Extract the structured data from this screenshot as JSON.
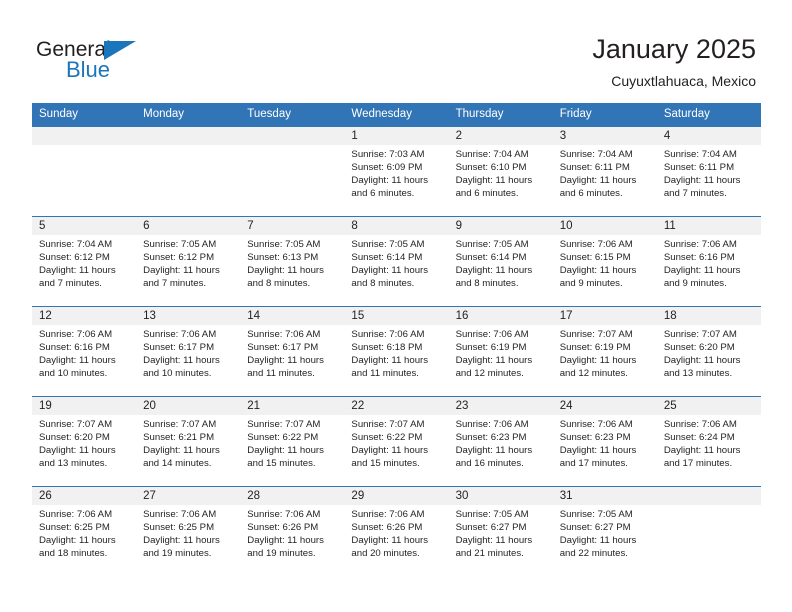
{
  "brand": {
    "name_dark": "General",
    "name_blue": "Blue",
    "accent_color": "#1b75bb"
  },
  "header": {
    "title": "January 2025",
    "subtitle": "Cuyuxtlahuaca, Mexico"
  },
  "colors": {
    "header_blue": "#3275b6",
    "date_band_gray": "#f1f1f1",
    "text": "#231f20"
  },
  "weekdays": [
    "Sunday",
    "Monday",
    "Tuesday",
    "Wednesday",
    "Thursday",
    "Friday",
    "Saturday"
  ],
  "weeks": [
    [
      {
        "day": "",
        "empty": true,
        "sunrise": "",
        "sunset": "",
        "daylight1": "",
        "daylight2": ""
      },
      {
        "day": "",
        "empty": true,
        "sunrise": "",
        "sunset": "",
        "daylight1": "",
        "daylight2": ""
      },
      {
        "day": "",
        "empty": true,
        "sunrise": "",
        "sunset": "",
        "daylight1": "",
        "daylight2": ""
      },
      {
        "day": "1",
        "empty": false,
        "sunrise": "Sunrise: 7:03 AM",
        "sunset": "Sunset: 6:09 PM",
        "daylight1": "Daylight: 11 hours",
        "daylight2": "and 6 minutes."
      },
      {
        "day": "2",
        "empty": false,
        "sunrise": "Sunrise: 7:04 AM",
        "sunset": "Sunset: 6:10 PM",
        "daylight1": "Daylight: 11 hours",
        "daylight2": "and 6 minutes."
      },
      {
        "day": "3",
        "empty": false,
        "sunrise": "Sunrise: 7:04 AM",
        "sunset": "Sunset: 6:11 PM",
        "daylight1": "Daylight: 11 hours",
        "daylight2": "and 6 minutes."
      },
      {
        "day": "4",
        "empty": false,
        "sunrise": "Sunrise: 7:04 AM",
        "sunset": "Sunset: 6:11 PM",
        "daylight1": "Daylight: 11 hours",
        "daylight2": "and 7 minutes."
      }
    ],
    [
      {
        "day": "5",
        "empty": false,
        "sunrise": "Sunrise: 7:04 AM",
        "sunset": "Sunset: 6:12 PM",
        "daylight1": "Daylight: 11 hours",
        "daylight2": "and 7 minutes."
      },
      {
        "day": "6",
        "empty": false,
        "sunrise": "Sunrise: 7:05 AM",
        "sunset": "Sunset: 6:12 PM",
        "daylight1": "Daylight: 11 hours",
        "daylight2": "and 7 minutes."
      },
      {
        "day": "7",
        "empty": false,
        "sunrise": "Sunrise: 7:05 AM",
        "sunset": "Sunset: 6:13 PM",
        "daylight1": "Daylight: 11 hours",
        "daylight2": "and 8 minutes."
      },
      {
        "day": "8",
        "empty": false,
        "sunrise": "Sunrise: 7:05 AM",
        "sunset": "Sunset: 6:14 PM",
        "daylight1": "Daylight: 11 hours",
        "daylight2": "and 8 minutes."
      },
      {
        "day": "9",
        "empty": false,
        "sunrise": "Sunrise: 7:05 AM",
        "sunset": "Sunset: 6:14 PM",
        "daylight1": "Daylight: 11 hours",
        "daylight2": "and 8 minutes."
      },
      {
        "day": "10",
        "empty": false,
        "sunrise": "Sunrise: 7:06 AM",
        "sunset": "Sunset: 6:15 PM",
        "daylight1": "Daylight: 11 hours",
        "daylight2": "and 9 minutes."
      },
      {
        "day": "11",
        "empty": false,
        "sunrise": "Sunrise: 7:06 AM",
        "sunset": "Sunset: 6:16 PM",
        "daylight1": "Daylight: 11 hours",
        "daylight2": "and 9 minutes."
      }
    ],
    [
      {
        "day": "12",
        "empty": false,
        "sunrise": "Sunrise: 7:06 AM",
        "sunset": "Sunset: 6:16 PM",
        "daylight1": "Daylight: 11 hours",
        "daylight2": "and 10 minutes."
      },
      {
        "day": "13",
        "empty": false,
        "sunrise": "Sunrise: 7:06 AM",
        "sunset": "Sunset: 6:17 PM",
        "daylight1": "Daylight: 11 hours",
        "daylight2": "and 10 minutes."
      },
      {
        "day": "14",
        "empty": false,
        "sunrise": "Sunrise: 7:06 AM",
        "sunset": "Sunset: 6:17 PM",
        "daylight1": "Daylight: 11 hours",
        "daylight2": "and 11 minutes."
      },
      {
        "day": "15",
        "empty": false,
        "sunrise": "Sunrise: 7:06 AM",
        "sunset": "Sunset: 6:18 PM",
        "daylight1": "Daylight: 11 hours",
        "daylight2": "and 11 minutes."
      },
      {
        "day": "16",
        "empty": false,
        "sunrise": "Sunrise: 7:06 AM",
        "sunset": "Sunset: 6:19 PM",
        "daylight1": "Daylight: 11 hours",
        "daylight2": "and 12 minutes."
      },
      {
        "day": "17",
        "empty": false,
        "sunrise": "Sunrise: 7:07 AM",
        "sunset": "Sunset: 6:19 PM",
        "daylight1": "Daylight: 11 hours",
        "daylight2": "and 12 minutes."
      },
      {
        "day": "18",
        "empty": false,
        "sunrise": "Sunrise: 7:07 AM",
        "sunset": "Sunset: 6:20 PM",
        "daylight1": "Daylight: 11 hours",
        "daylight2": "and 13 minutes."
      }
    ],
    [
      {
        "day": "19",
        "empty": false,
        "sunrise": "Sunrise: 7:07 AM",
        "sunset": "Sunset: 6:20 PM",
        "daylight1": "Daylight: 11 hours",
        "daylight2": "and 13 minutes."
      },
      {
        "day": "20",
        "empty": false,
        "sunrise": "Sunrise: 7:07 AM",
        "sunset": "Sunset: 6:21 PM",
        "daylight1": "Daylight: 11 hours",
        "daylight2": "and 14 minutes."
      },
      {
        "day": "21",
        "empty": false,
        "sunrise": "Sunrise: 7:07 AM",
        "sunset": "Sunset: 6:22 PM",
        "daylight1": "Daylight: 11 hours",
        "daylight2": "and 15 minutes."
      },
      {
        "day": "22",
        "empty": false,
        "sunrise": "Sunrise: 7:07 AM",
        "sunset": "Sunset: 6:22 PM",
        "daylight1": "Daylight: 11 hours",
        "daylight2": "and 15 minutes."
      },
      {
        "day": "23",
        "empty": false,
        "sunrise": "Sunrise: 7:06 AM",
        "sunset": "Sunset: 6:23 PM",
        "daylight1": "Daylight: 11 hours",
        "daylight2": "and 16 minutes."
      },
      {
        "day": "24",
        "empty": false,
        "sunrise": "Sunrise: 7:06 AM",
        "sunset": "Sunset: 6:23 PM",
        "daylight1": "Daylight: 11 hours",
        "daylight2": "and 17 minutes."
      },
      {
        "day": "25",
        "empty": false,
        "sunrise": "Sunrise: 7:06 AM",
        "sunset": "Sunset: 6:24 PM",
        "daylight1": "Daylight: 11 hours",
        "daylight2": "and 17 minutes."
      }
    ],
    [
      {
        "day": "26",
        "empty": false,
        "sunrise": "Sunrise: 7:06 AM",
        "sunset": "Sunset: 6:25 PM",
        "daylight1": "Daylight: 11 hours",
        "daylight2": "and 18 minutes."
      },
      {
        "day": "27",
        "empty": false,
        "sunrise": "Sunrise: 7:06 AM",
        "sunset": "Sunset: 6:25 PM",
        "daylight1": "Daylight: 11 hours",
        "daylight2": "and 19 minutes."
      },
      {
        "day": "28",
        "empty": false,
        "sunrise": "Sunrise: 7:06 AM",
        "sunset": "Sunset: 6:26 PM",
        "daylight1": "Daylight: 11 hours",
        "daylight2": "and 19 minutes."
      },
      {
        "day": "29",
        "empty": false,
        "sunrise": "Sunrise: 7:06 AM",
        "sunset": "Sunset: 6:26 PM",
        "daylight1": "Daylight: 11 hours",
        "daylight2": "and 20 minutes."
      },
      {
        "day": "30",
        "empty": false,
        "sunrise": "Sunrise: 7:05 AM",
        "sunset": "Sunset: 6:27 PM",
        "daylight1": "Daylight: 11 hours",
        "daylight2": "and 21 minutes."
      },
      {
        "day": "31",
        "empty": false,
        "sunrise": "Sunrise: 7:05 AM",
        "sunset": "Sunset: 6:27 PM",
        "daylight1": "Daylight: 11 hours",
        "daylight2": "and 22 minutes."
      },
      {
        "day": "",
        "empty": true,
        "sunrise": "",
        "sunset": "",
        "daylight1": "",
        "daylight2": ""
      }
    ]
  ]
}
